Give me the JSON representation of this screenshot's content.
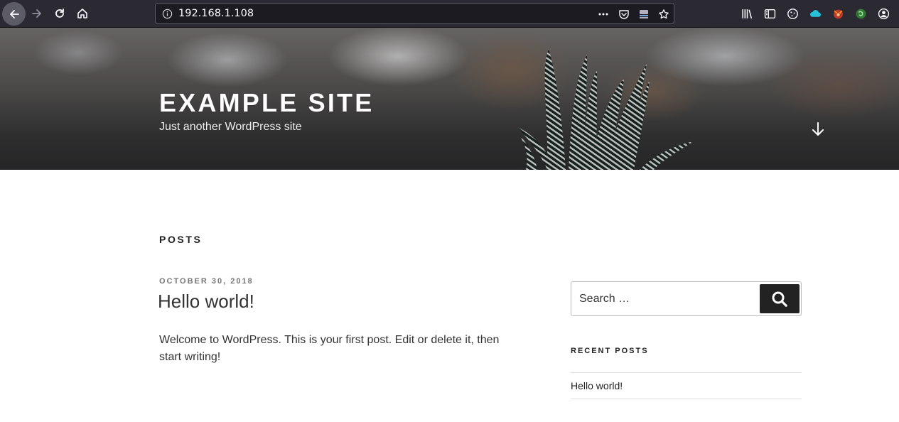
{
  "browser": {
    "url": "192.168.1.108",
    "icons": {
      "back": "back-arrow-icon",
      "forward": "forward-arrow-icon",
      "reload": "reload-icon",
      "home": "home-icon",
      "site_info": "info-icon",
      "page_actions": "more-horizontal-icon",
      "pocket": "pocket-icon",
      "reader": "reader-view-icon",
      "bookmark": "star-icon",
      "library": "library-icon",
      "sidebar": "sidebar-icon",
      "cookie": "cookie-icon",
      "cloud": "cloud-icon",
      "foxyproxy": "fox-extension-icon",
      "wappalyzer": "wappalyzer-icon",
      "account": "account-icon"
    }
  },
  "site": {
    "title": "EXAMPLE SITE",
    "tagline": "Just another WordPress site"
  },
  "content": {
    "page_heading": "POSTS",
    "posts": [
      {
        "date": "OCTOBER 30, 2018",
        "title": "Hello world!",
        "excerpt": "Welcome to WordPress. This is your first post. Edit or delete it, then start writing!"
      }
    ]
  },
  "sidebar": {
    "search_placeholder": "Search …",
    "recent_posts_title": "RECENT POSTS",
    "recent_posts": [
      "Hello world!"
    ]
  },
  "colors": {
    "toolbar_bg": "#2b2a33",
    "urlbar_bg": "#1c1b22",
    "search_button_bg": "#222222",
    "text_dark": "#222222",
    "text_meta": "#767676"
  }
}
